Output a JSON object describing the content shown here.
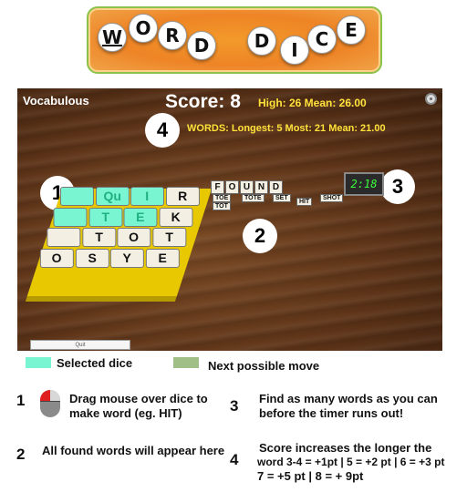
{
  "banner": {
    "tiles": [
      "W",
      "O",
      "R",
      "D",
      "D",
      "I",
      "C",
      "E"
    ]
  },
  "game": {
    "app_title": "Vocabulous",
    "score": "Score: 8",
    "stats": "High: 26 Mean: 26.00",
    "words_stats": "WORDS: Longest: 5 Most: 21 Mean: 21.00",
    "timer": "2:18",
    "found_label": [
      "F",
      "O",
      "U",
      "N",
      "D"
    ],
    "found_words": [
      "TOE",
      "TOT",
      "TOTE",
      "SET",
      "HIT",
      "SHOT"
    ],
    "grid": [
      [
        "",
        "Qu",
        "I",
        "R"
      ],
      [
        "",
        "T",
        "E",
        "K"
      ],
      [
        "",
        "T",
        "O",
        "T"
      ],
      [
        "O",
        "S",
        "Y",
        "E"
      ]
    ],
    "quit_label": "Quit",
    "markers": [
      "1",
      "2",
      "3",
      "4"
    ]
  },
  "legend": {
    "selected_label": "Selected dice",
    "selected_color": "#7af5d2",
    "next_label": "Next possible move",
    "next_color": "#9fbf86"
  },
  "help": {
    "n1": "1",
    "t1": "Drag mouse over dice to make word (eg. HIT)",
    "n2": "2",
    "t2": "All found words will appear here",
    "n3": "3",
    "t3": "Find as many words as you can before the timer runs out!",
    "n4": "4",
    "t4a": "Score increases the longer the",
    "t4b": "word 3-4 = +1pt | 5 = +2 pt | 6 = +3 pt",
    "t4c": "7 = +5 pt | 8 = + 9pt"
  }
}
